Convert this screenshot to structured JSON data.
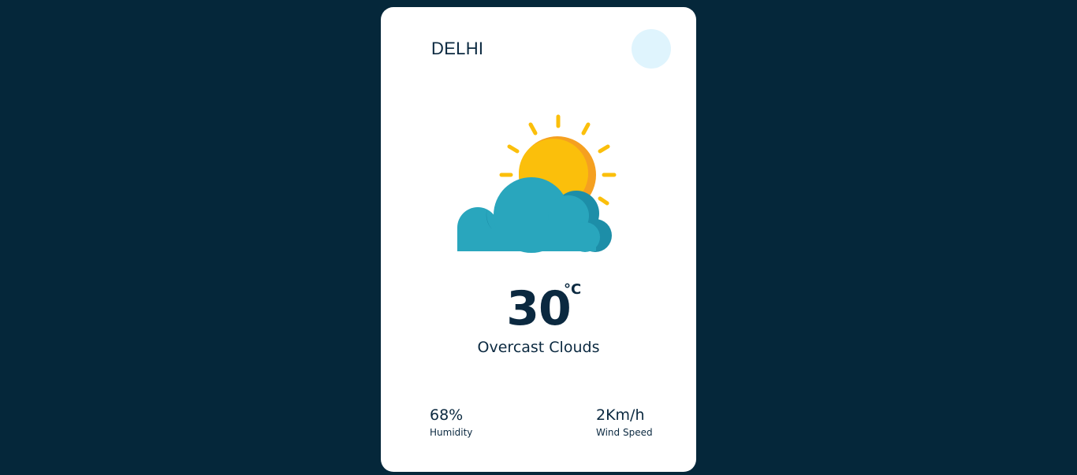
{
  "search": {
    "value": "DELHI",
    "button_color": "#dff4fd"
  },
  "weather": {
    "icon": "partly-cloudy-sun-icon",
    "temperature": "30",
    "unit": "°C",
    "description": "Overcast Clouds"
  },
  "stats": {
    "humidity": {
      "value": "68%",
      "label": "Humidity"
    },
    "wind": {
      "value": "2Km/h",
      "label": "Wind Speed"
    }
  },
  "colors": {
    "background": "#05273a",
    "card": "#ffffff",
    "text": "#0b2940",
    "sun": "#fbbf0b",
    "sun_shade": "#f5a020",
    "cloud": "#29a6bd",
    "cloud_shade": "#1d8ea8"
  }
}
